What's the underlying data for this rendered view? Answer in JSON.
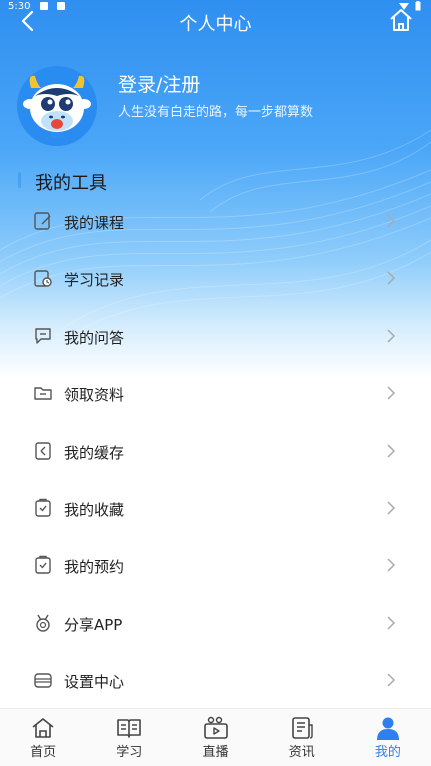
{
  "status_bar": {
    "time": "5:30"
  },
  "header": {
    "title": "个人中心"
  },
  "profile": {
    "login_label": "登录/注册",
    "motto": "人生没有白走的路，每一步都算数"
  },
  "tools": {
    "title": "我的工具",
    "items": [
      {
        "label": "我的课程",
        "icon": "course-icon"
      },
      {
        "label": "学习记录",
        "icon": "study-record-icon"
      },
      {
        "label": "我的问答",
        "icon": "qa-icon"
      },
      {
        "label": "领取资料",
        "icon": "folder-icon"
      },
      {
        "label": "我的缓存",
        "icon": "cache-icon"
      },
      {
        "label": "我的收藏",
        "icon": "favorite-icon"
      },
      {
        "label": "我的预约",
        "icon": "reservation-icon"
      },
      {
        "label": "分享APP",
        "icon": "medal-icon"
      },
      {
        "label": "设置中心",
        "icon": "settings-icon"
      }
    ]
  },
  "tabbar": {
    "active_color": "#2f7ff0",
    "items": [
      {
        "label": "首页",
        "icon": "home-icon"
      },
      {
        "label": "学习",
        "icon": "book-icon"
      },
      {
        "label": "直播",
        "icon": "live-icon"
      },
      {
        "label": "资讯",
        "icon": "news-icon"
      },
      {
        "label": "我的",
        "icon": "user-icon",
        "active": true
      }
    ]
  }
}
